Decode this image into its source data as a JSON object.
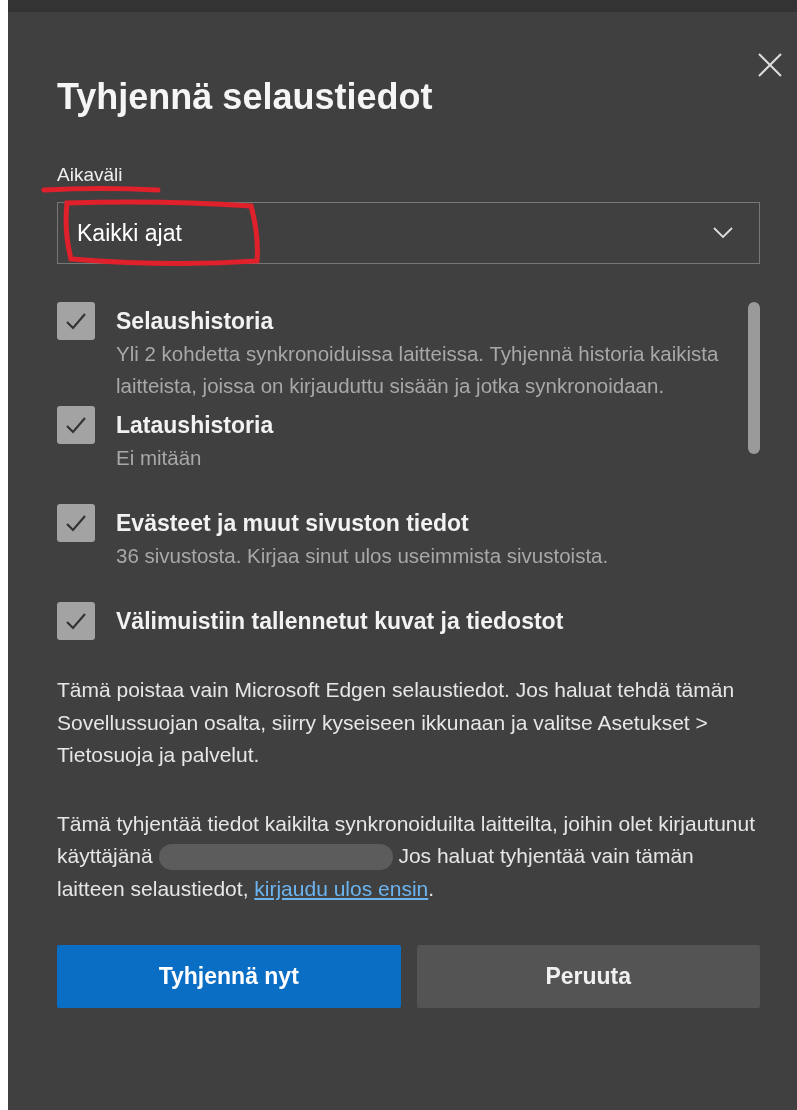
{
  "dialog": {
    "title": "Tyhjennä selaustiedot"
  },
  "time_range": {
    "label": "Aikaväli",
    "value": "Kaikki ajat"
  },
  "items": [
    {
      "title": "Selaushistoria",
      "description": "Yli 2 kohdetta synkronoiduissa laitteissa. Tyhjennä historia kaikista laitteista, joissa on kirjauduttu sisään ja jotka synkronoidaan.",
      "checked": true
    },
    {
      "title": "Lataushistoria",
      "description": "Ei mitään",
      "checked": true
    },
    {
      "title": "Evästeet ja muut sivuston tiedot",
      "description": "36 sivustosta. Kirjaa sinut ulos useimmista sivustoista.",
      "checked": true
    },
    {
      "title": "Välimuistiin tallennetut kuvat ja tiedostot",
      "checked": true
    }
  ],
  "notes": [
    {
      "text": "Tämä poistaa vain Microsoft Edgen selaustiedot. Jos haluat tehdä tämän Sovellussuojan osalta, siirry kyseiseen ikkunaan ja valitse Asetukset > Tietosuoja ja palvelut."
    },
    {
      "text": "Tämä tyhjentää tiedot kaikilta synkronoiduilta laitteilta, joihin olet kirjautunut käyttäjänä",
      "after_redaction": "Jos haluat tyhjentää vain tämän laitteen selaustiedot,",
      "link": "kirjaudu ulos ensin",
      "end": "."
    }
  ],
  "buttons": [
    {
      "label": "Tyhjennä nyt",
      "kind": "primary"
    },
    {
      "label": "Peruuta",
      "kind": "secondary"
    }
  ]
}
